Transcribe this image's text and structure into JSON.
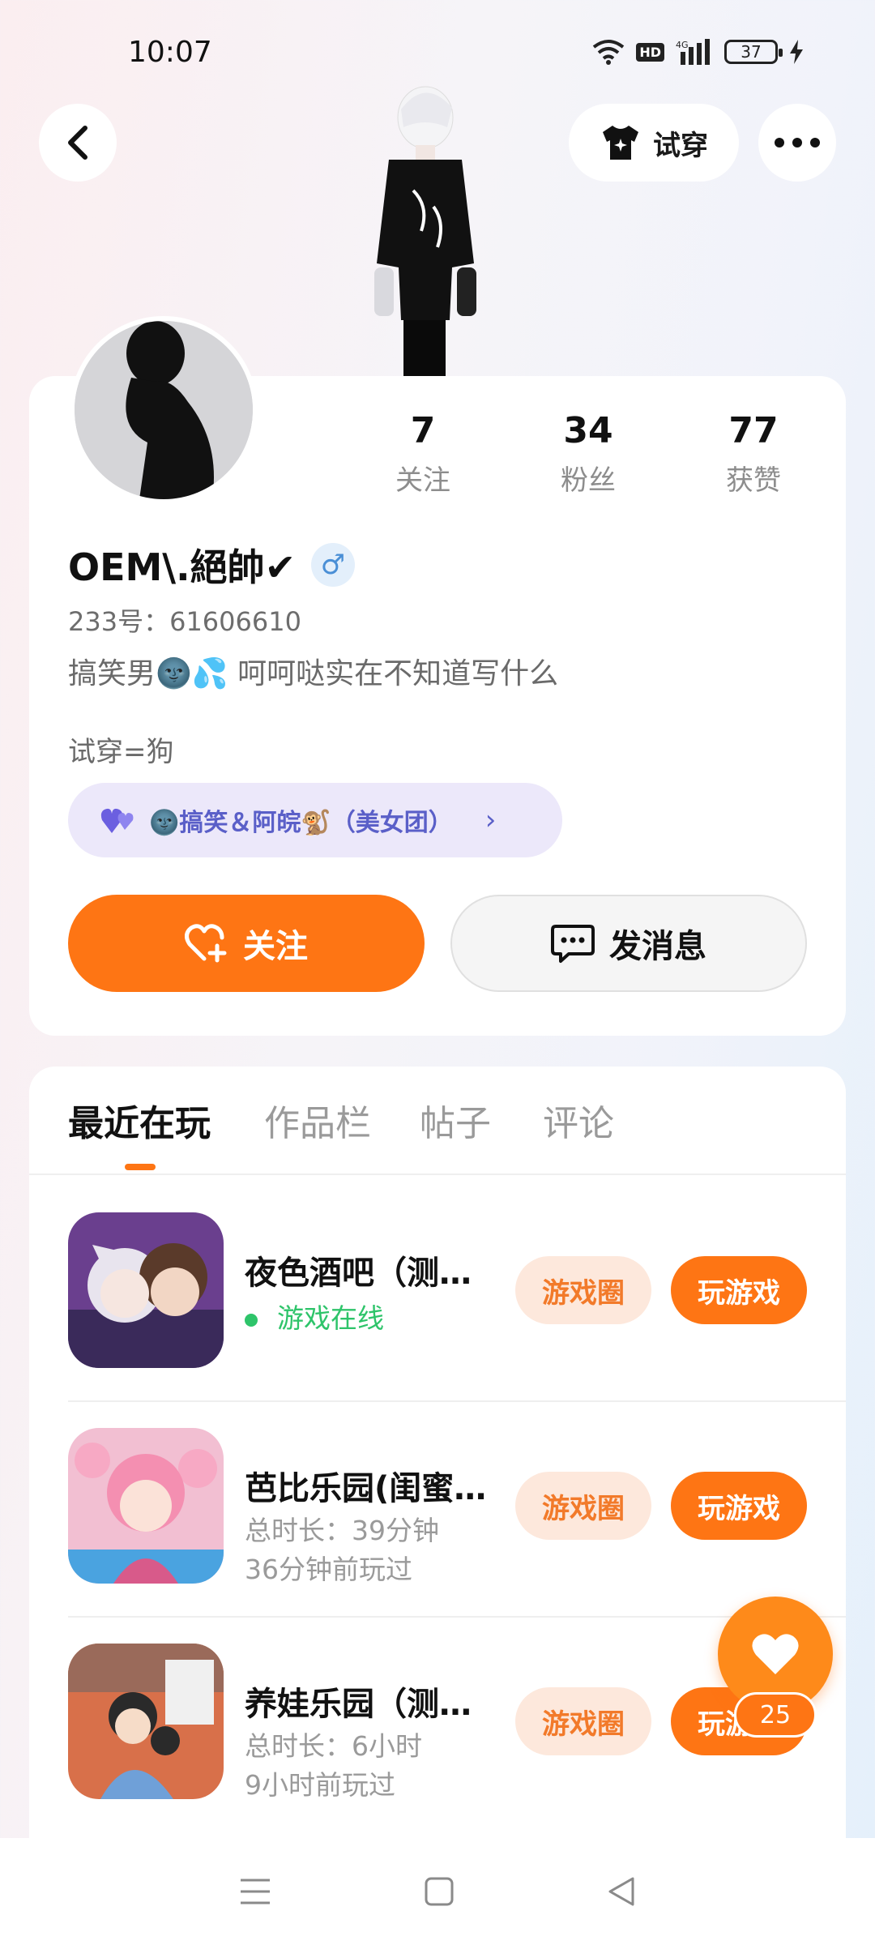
{
  "status_bar": {
    "time": "10:07",
    "battery": "37",
    "network": "4G",
    "hd": "HD"
  },
  "header": {
    "tryon_label": "试穿"
  },
  "profile": {
    "stats": [
      {
        "value": "7",
        "label": "关注"
      },
      {
        "value": "34",
        "label": "粉丝"
      },
      {
        "value": "77",
        "label": "获赞"
      }
    ],
    "username": "OEM\\.絕帥✔",
    "gender_symbol": "♂",
    "user_id": "233号：61606610",
    "bio_line1": "搞笑男🌚💦    呵呵哒实在不知道写什么",
    "bio_line2": "试穿=狗",
    "group": {
      "label": "🌚搞笑＆阿皖🐒（美女团）"
    },
    "follow_label": "关注",
    "message_label": "发消息"
  },
  "tabs": [
    "最近在玩",
    "作品栏",
    "帖子",
    "评论"
  ],
  "games": [
    {
      "name": "夜色酒吧（测试版）",
      "line1": "游戏在线",
      "line2": "",
      "circle_label": "游戏圈",
      "play_label": "玩游戏"
    },
    {
      "name": "芭比乐园(闺蜜版)",
      "line1": "总时长：39分钟",
      "line2": "36分钟前玩过",
      "circle_label": "游戏圈",
      "play_label": "玩游戏"
    },
    {
      "name": "养娃乐园（测试版）",
      "line1": "总时长：6小时",
      "line2": "9小时前玩过",
      "circle_label": "游戏圈",
      "play_label": "玩游戏"
    }
  ],
  "like_fab": {
    "count": "25"
  },
  "colors": {
    "accent": "#fe7514",
    "online": "#2ec46a",
    "gender": "#4a8fd6",
    "group_text": "#5a5fc8"
  }
}
